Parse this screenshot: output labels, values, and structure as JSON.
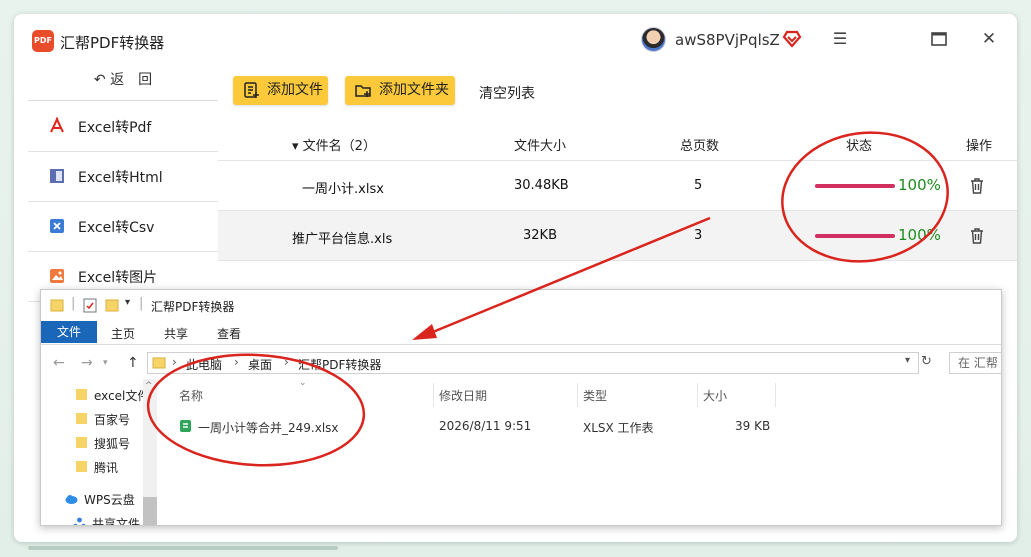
{
  "app": {
    "title": "汇帮PDF转换器",
    "logo_text": "PDF",
    "user": "awS8PVjPqlsZ"
  },
  "sidebar": {
    "back_label": "返　回",
    "items": [
      {
        "label": "Excel转Pdf",
        "icon": "pdf-icon"
      },
      {
        "label": "Excel转Html",
        "icon": "html-icon"
      },
      {
        "label": "Excel转Csv",
        "icon": "csv-icon"
      },
      {
        "label": "Excel转图片",
        "icon": "image-icon"
      }
    ]
  },
  "toolbar": {
    "add_file": "添加文件",
    "add_folder": "添加文件夹",
    "clear_list": "清空列表"
  },
  "table": {
    "headers": {
      "name": "文件名（2）",
      "size": "文件大小",
      "pages": "总页数",
      "status": "状态",
      "action": "操作"
    },
    "rows": [
      {
        "name": "一周小计.xlsx",
        "size": "30.48KB",
        "pages": "5",
        "progress": 100,
        "progress_text": "100%"
      },
      {
        "name": "推广平台信息.xls",
        "size": "32KB",
        "pages": "3",
        "progress": 100,
        "progress_text": "100%"
      }
    ]
  },
  "explorer": {
    "title": "汇帮PDF转换器",
    "ribbon": {
      "file": "文件",
      "home": "主页",
      "share": "共享",
      "view": "查看"
    },
    "path": [
      "此电脑",
      "桌面",
      "汇帮PDF转换器"
    ],
    "search_placeholder": "在 汇帮",
    "nav": [
      "excel文件",
      "百家号",
      "搜狐号",
      "腾讯",
      "WPS云盘",
      "共享文件"
    ],
    "columns": {
      "name": "名称",
      "modified": "修改日期",
      "type": "类型",
      "size": "大小"
    },
    "files": [
      {
        "name": "一周小计等合并_249.xlsx",
        "modified": "2026/8/11 9:51",
        "type": "XLSX 工作表",
        "size": "39 KB"
      }
    ]
  },
  "colors": {
    "accent_yellow": "#fcc93a",
    "progress": "#d12f5e",
    "success": "#1e8c1e",
    "annotation": "#d9251d",
    "ribbon_blue": "#1a66b8"
  }
}
